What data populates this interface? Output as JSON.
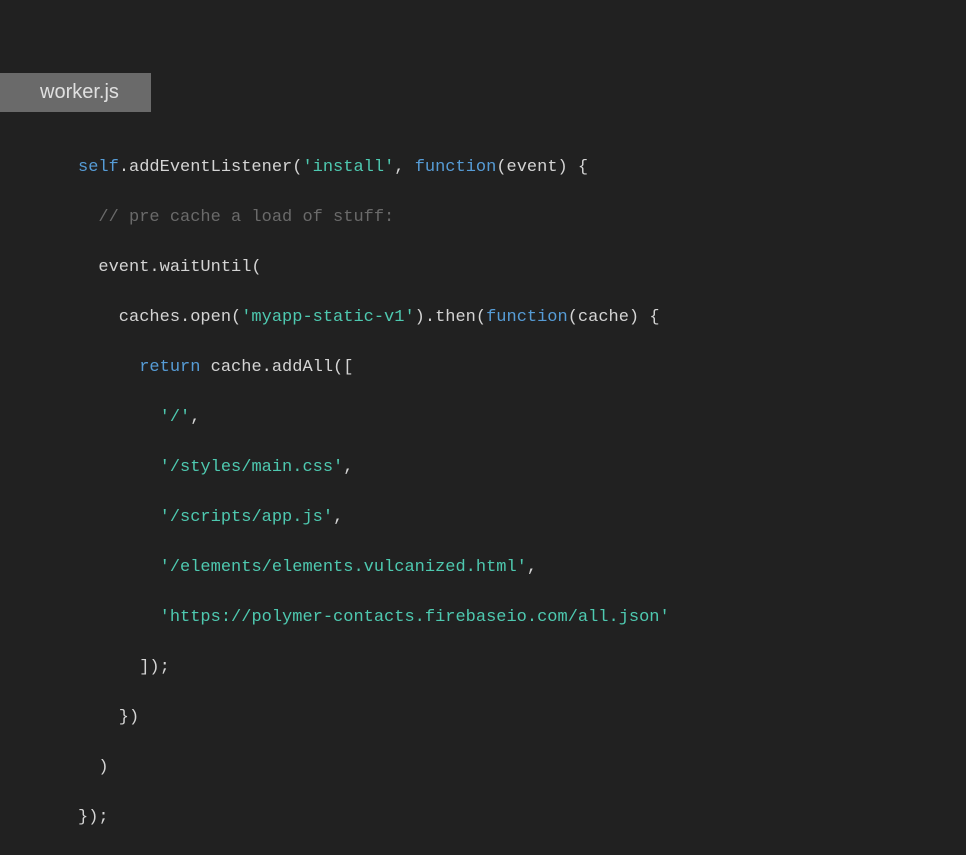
{
  "tab": {
    "label": "worker.js"
  },
  "code": {
    "l1": {
      "a": "self",
      "b": ".addEventListener(",
      "c": "'install'",
      "d": ", ",
      "e": "function",
      "f": "(event) {"
    },
    "l2": {
      "a": "  ",
      "b": "// pre cache a load of stuff:"
    },
    "l3": {
      "a": "  event.waitUntil("
    },
    "l4": {
      "a": "    caches.open(",
      "b": "'myapp-static-v1'",
      "c": ").then(",
      "d": "function",
      "e": "(cache) {"
    },
    "l5": {
      "a": "      ",
      "b": "return",
      "c": " cache.addAll(["
    },
    "l6": {
      "a": "        ",
      "b": "'/'",
      "c": ","
    },
    "l7": {
      "a": "        ",
      "b": "'/styles/main.css'",
      "c": ","
    },
    "l8": {
      "a": "        ",
      "b": "'/scripts/app.js'",
      "c": ","
    },
    "l9": {
      "a": "        ",
      "b": "'/elements/elements.vulcanized.html'",
      "c": ","
    },
    "l10": {
      "a": "        ",
      "b": "'https://polymer-contacts.firebaseio.com/all.json'"
    },
    "l11": {
      "a": "      ]);"
    },
    "l12": {
      "a": "    })"
    },
    "l13": {
      "a": "  )"
    },
    "l14": {
      "a": "});"
    }
  }
}
